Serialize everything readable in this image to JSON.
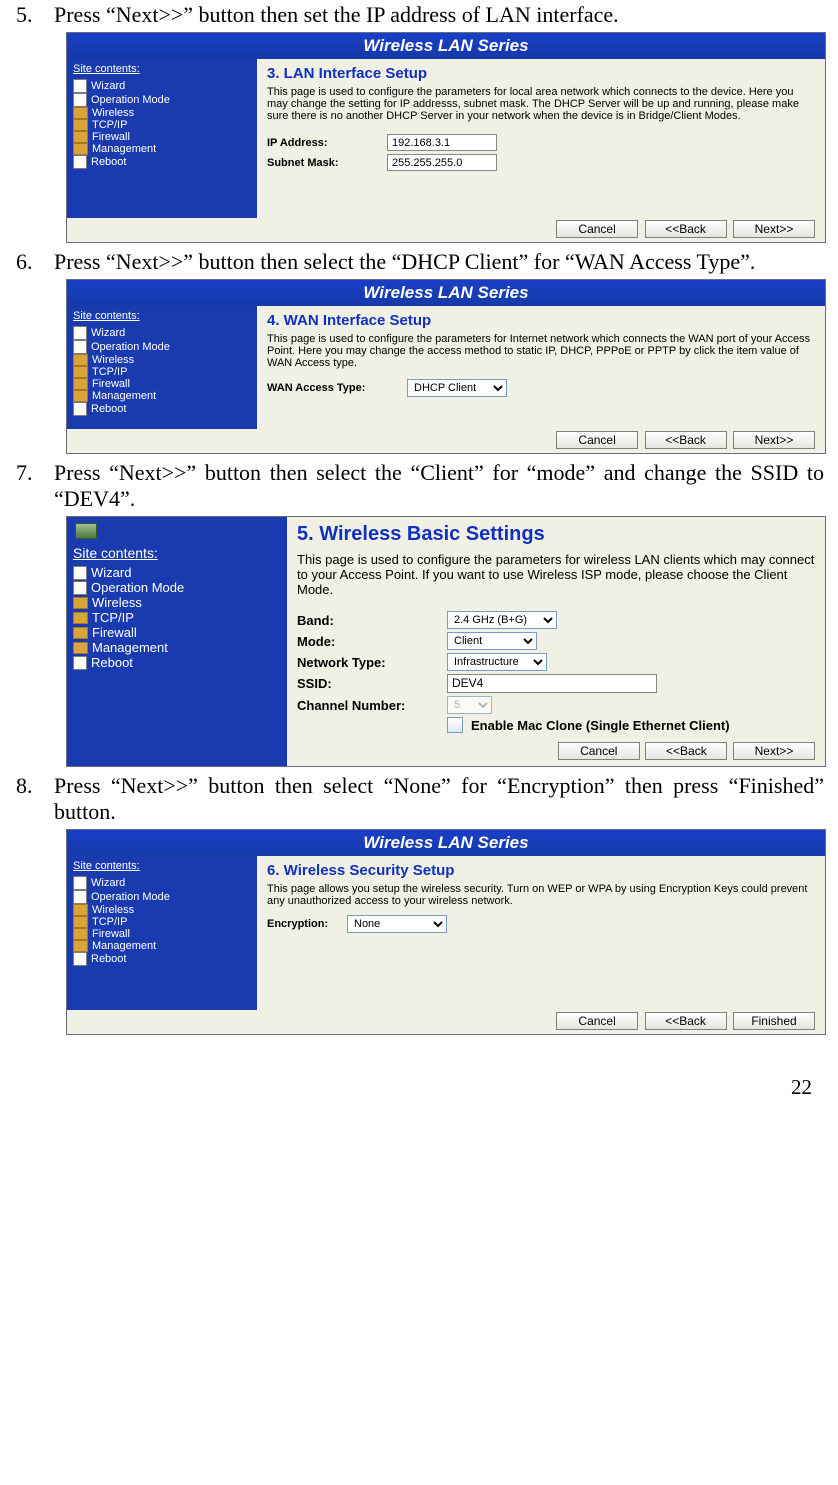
{
  "steps": {
    "s5": {
      "num": "5.",
      "text": "Press “Next>>” button then set the IP address of LAN interface."
    },
    "s6": {
      "num": "6.",
      "text": "Press “Next>>” button then select the “DHCP Client” for “WAN Access Type”."
    },
    "s7": {
      "num": "7.",
      "text": "Press “Next>>” button then select the “Client” for “mode” and change the SSID to “DEV4”."
    },
    "s8": {
      "num": "8.",
      "text": "Press “Next>>” button then select “None” for “Encryption” then press “Finished” button."
    }
  },
  "common": {
    "title": "Wireless LAN Series",
    "sidebar_title": "Site contents:",
    "btn_cancel": "Cancel",
    "btn_back": "<<Back",
    "btn_next": "Next>>",
    "btn_finished": "Finished"
  },
  "sidebar": [
    {
      "label": "Wizard",
      "icon": "doc"
    },
    {
      "label": "Operation Mode",
      "icon": "doc"
    },
    {
      "label": "Wireless",
      "icon": "folder"
    },
    {
      "label": "TCP/IP",
      "icon": "folder"
    },
    {
      "label": "Firewall",
      "icon": "folder"
    },
    {
      "label": "Management",
      "icon": "folder"
    },
    {
      "label": "Reboot",
      "icon": "doc"
    }
  ],
  "shot5": {
    "heading": "3. LAN Interface Setup",
    "desc": "This page is used to configure the parameters for local area network which connects to the device. Here you may change the setting for IP addresss, subnet mask. The DHCP Server will be up and running, please make sure there is no another DHCP Server in your network when the device is in Bridge/Client Modes.",
    "ip_label": "IP Address:",
    "ip_value": "192.168.3.1",
    "mask_label": "Subnet Mask:",
    "mask_value": "255.255.255.0"
  },
  "shot6": {
    "heading": "4. WAN Interface Setup",
    "desc": "This page is used to configure the parameters for Internet network which connects the WAN port of your Access Point. Here you may change the access method to static IP, DHCP, PPPoE or PPTP by click the item value of WAN Access type.",
    "access_label": "WAN Access Type:",
    "access_value": "DHCP Client"
  },
  "shot7": {
    "heading": "5. Wireless Basic Settings",
    "desc": "This page is used to configure the parameters for wireless LAN clients which may connect to your Access Point. If you want to use Wireless ISP mode, please choose the Client Mode.",
    "band_label": "Band:",
    "band_value": "2.4 GHz (B+G)",
    "mode_label": "Mode:",
    "mode_value": "Client",
    "nettype_label": "Network Type:",
    "nettype_value": "Infrastructure",
    "ssid_label": "SSID:",
    "ssid_value": "DEV4",
    "chan_label": "Channel Number:",
    "chan_value": "5",
    "macclone": "Enable Mac Clone (Single Ethernet Client)"
  },
  "shot8": {
    "heading": "6. Wireless Security Setup",
    "desc": "This page allows you setup the wireless security. Turn on WEP or WPA by using Encryption Keys could prevent any unauthorized access to your wireless network.",
    "enc_label": "Encryption:",
    "enc_value": "None"
  },
  "page_number": "22"
}
